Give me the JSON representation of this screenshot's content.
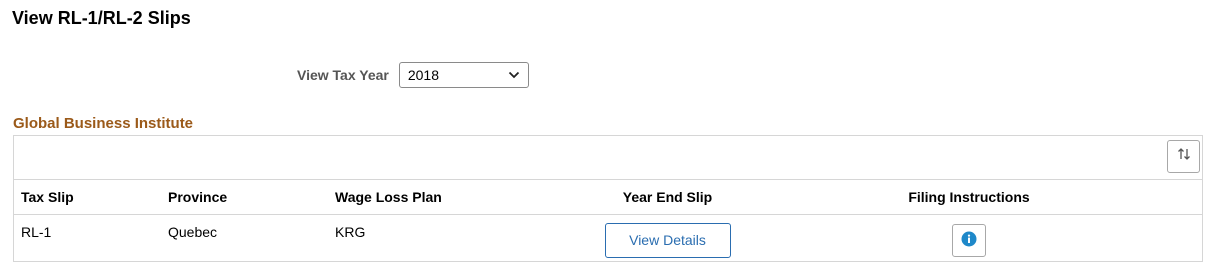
{
  "page": {
    "title": "View RL-1/RL-2 Slips"
  },
  "tax_year": {
    "label": "View Tax Year",
    "selected": "2018"
  },
  "section": {
    "title": "Global Business Institute"
  },
  "table": {
    "columns": {
      "tax_slip": "Tax Slip",
      "province": "Province",
      "wage_loss_plan": "Wage Loss Plan",
      "year_end_slip": "Year End Slip",
      "filing_instructions": "Filing Instructions"
    },
    "rows": [
      {
        "tax_slip": "RL-1",
        "province": "Quebec",
        "wage_loss_plan": "KRG",
        "year_end_slip_button": "View Details",
        "filing_icon": "info-icon"
      }
    ]
  },
  "icons": {
    "sort": "sort-icon",
    "dropdown": "chevron-down-icon",
    "info": "info-icon"
  },
  "colors": {
    "section_title": "#9b5a1a",
    "link_blue": "#2a6db0",
    "info_blue": "#1e88c9"
  }
}
